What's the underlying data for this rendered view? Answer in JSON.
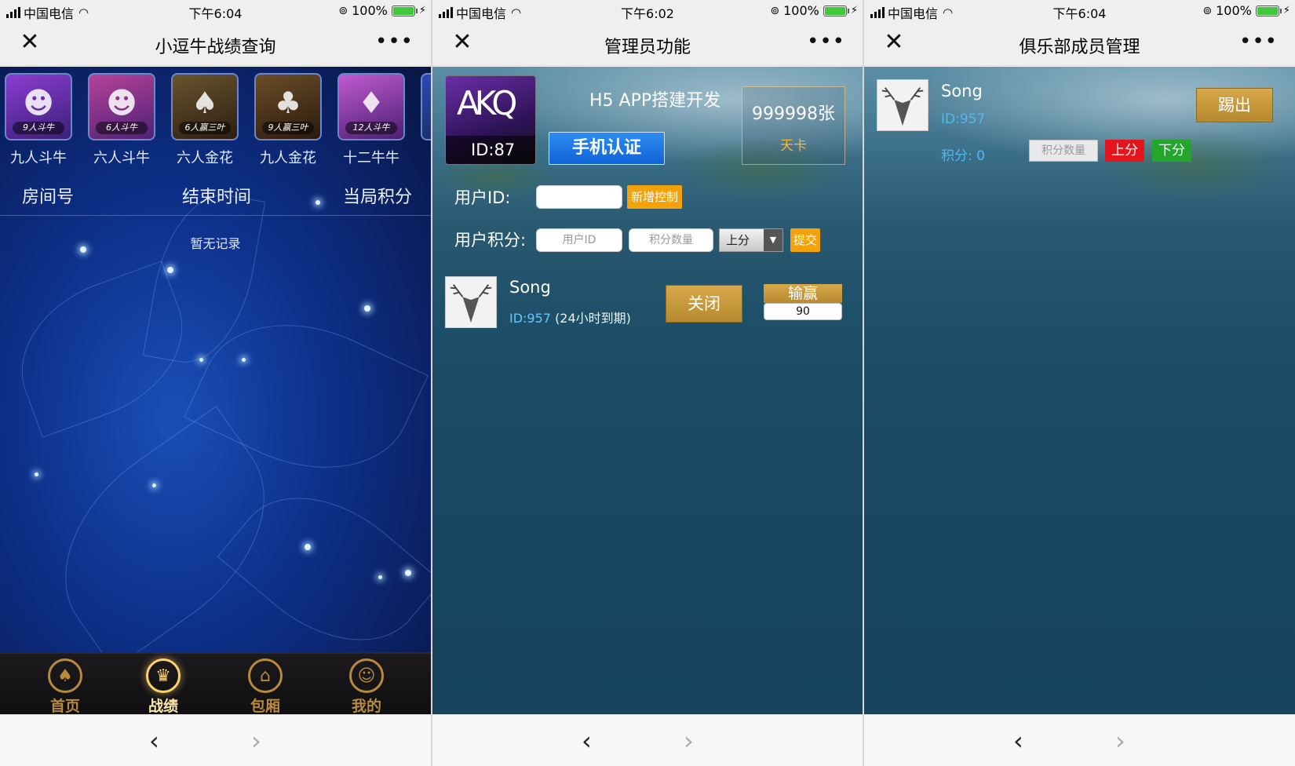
{
  "status": {
    "carrier": "中国电信",
    "battery": "100%",
    "times": [
      "下午6:04",
      "下午6:02",
      "下午6:04"
    ]
  },
  "screens": [
    {
      "title": "小逗牛战绩查询",
      "games": [
        {
          "badge": "9人斗牛",
          "label": "九人斗牛"
        },
        {
          "badge": "6人斗牛",
          "label": "六人斗牛"
        },
        {
          "badge": "6人赢三叶",
          "label": "六人金花"
        },
        {
          "badge": "9人赢三叶",
          "label": "九人金花"
        },
        {
          "badge": "12人斗牛",
          "label": "十二牛牛"
        }
      ],
      "columns": [
        "房间号",
        "结束时间",
        "当局积分"
      ],
      "empty_text": "暂无记录",
      "tabs": [
        {
          "label": "首页",
          "icon": "spade-icon"
        },
        {
          "label": "战绩",
          "icon": "trophy-icon"
        },
        {
          "label": "包厢",
          "icon": "home-icon"
        },
        {
          "label": "我的",
          "icon": "user-icon"
        }
      ]
    },
    {
      "title": "管理员功能",
      "logo_id": "ID:87",
      "brand": "H5 APP搭建开发",
      "verify_button": "手机认证",
      "card_count": "999998张",
      "card_type": "天卡",
      "user_id_label": "用户ID:",
      "add_control_button": "新增控制",
      "score_label": "用户积分:",
      "user_id_placeholder": "用户ID",
      "amount_placeholder": "积分数量",
      "direction_value": "上分",
      "submit_button": "提交",
      "member": {
        "name": "Song",
        "id": "ID:957",
        "expiry": "(24小时到期)",
        "close_button": "关闭",
        "winloss_label": "输赢",
        "winloss_value": "90"
      }
    },
    {
      "title": "俱乐部成员管理",
      "member": {
        "name": "Song",
        "id": "ID:957",
        "score": "积分: 0",
        "kick_button": "踢出",
        "amount_placeholder": "积分数量",
        "add_button": "上分",
        "sub_button": "下分"
      }
    }
  ],
  "colors": {
    "accent_gold": "#b88a3e",
    "button_orange": "#f4a20c",
    "id_blue": "#4fb9f0",
    "red": "#e5151d",
    "green": "#24a52c"
  }
}
